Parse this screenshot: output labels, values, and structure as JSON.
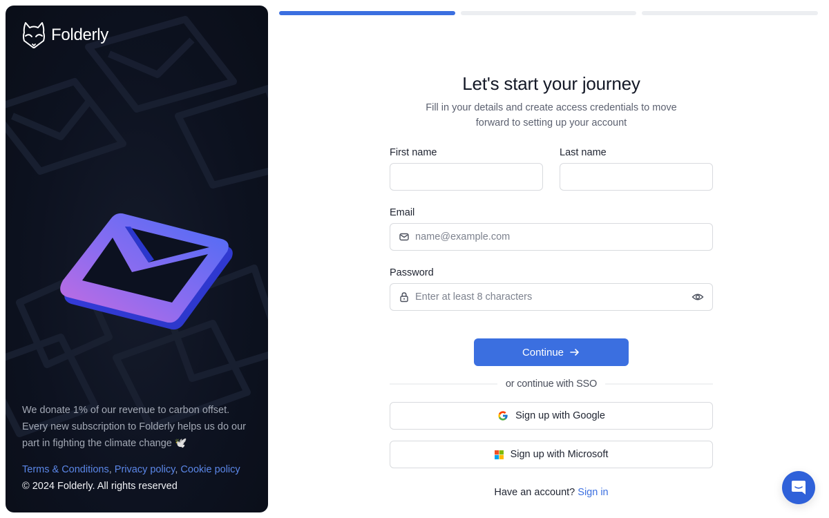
{
  "brand": {
    "name": "Folderly"
  },
  "sidebar": {
    "donate_text": "We donate 1% of our revenue to carbon offset. Every new subscription to Folderly helps us do our part in fighting the climate change 🕊️",
    "links": [
      {
        "label": "Terms & Conditions"
      },
      {
        "label": "Privacy policy"
      },
      {
        "label": "Cookie policy"
      }
    ],
    "link_separator": ", ",
    "copyright": "© 2024 Folderly. All rights reserved"
  },
  "progress": {
    "current_step": 1,
    "total_steps": 3,
    "active_color": "#3b6fe0"
  },
  "form": {
    "title": "Let's start your journey",
    "subtitle": "Fill in your details and create access credentials to move forward to setting up your account",
    "first_name": {
      "label": "First name",
      "value": "",
      "placeholder": ""
    },
    "last_name": {
      "label": "Last name",
      "value": "",
      "placeholder": ""
    },
    "email": {
      "label": "Email",
      "value": "",
      "placeholder": "name@example.com",
      "icon": "mail-icon"
    },
    "password": {
      "label": "Password",
      "value": "",
      "placeholder": "Enter at least 8 characters",
      "icon": "lock-icon",
      "toggle_icon": "eye-icon"
    },
    "continue_label": "Continue",
    "divider_text": "or continue with SSO",
    "google_label": "Sign up with Google",
    "microsoft_label": "Sign up with Microsoft",
    "have_account_text": "Have an account?",
    "sign_in_label": "Sign in"
  },
  "chat_widget": {
    "icon": "chat-icon"
  }
}
